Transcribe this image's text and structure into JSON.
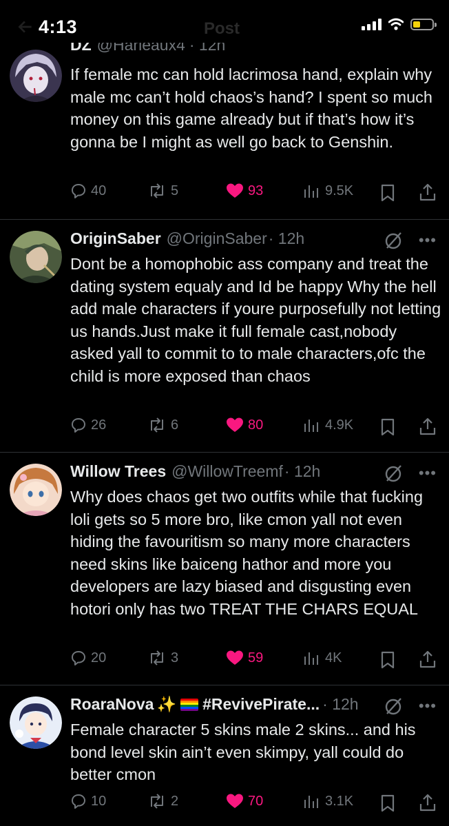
{
  "status_bar": {
    "time": "4:13",
    "title": "Post"
  },
  "tweets": [
    {
      "name": "DZ",
      "handle": "@Harleaux4",
      "time": "· 12h",
      "text": "If female mc can hold lacrimosa hand, explain why male mc can’t hold chaos’s hand? I spent so much money on this game already but if that’s how it’s gonna be I might as well go back to Genshin.",
      "replies": "40",
      "reposts": "5",
      "likes": "93",
      "views": "9.5K"
    },
    {
      "name": "OriginSaber",
      "handle": "@OriginSaber",
      "time": "· 12h",
      "text": "Dont be a homophobic ass company and treat the dating system equaly and Id be happy Why the hell add male characters if youre purposefully not letting us hands.Just make it full female cast,nobody asked yall to commit to to male characters,ofc the child is more exposed than chaos",
      "replies": "26",
      "reposts": "6",
      "likes": "80",
      "views": "4.9K"
    },
    {
      "name": "Willow Trees",
      "handle": "@WillowTreemf",
      "time": "· 12h",
      "text": "Why  does chaos get two outfits while that fucking loli gets so 5 more bro, like cmon yall not even hiding the favouritism so many more characters need skins like baiceng hathor and more you developers are lazy biased and disgusting even hotori only has two TREAT THE CHARS EQUAL",
      "replies": "20",
      "reposts": "3",
      "likes": "59",
      "views": "4K"
    },
    {
      "name": "RoaraNova",
      "name_emoji": "✨",
      "handle": "#RevivePirate...",
      "time": "· 12h",
      "text": "Female character 5 skins male 2 skins... and his bond level skin ain’t even skimpy, yall could do better cmon",
      "replies": "10",
      "reposts": "2",
      "likes": "70",
      "views": "3.1K"
    }
  ],
  "colors": {
    "background": "#000000",
    "text": "#e7e9ea",
    "muted": "#71767b",
    "like": "#f91880",
    "divider": "#2f3336"
  }
}
